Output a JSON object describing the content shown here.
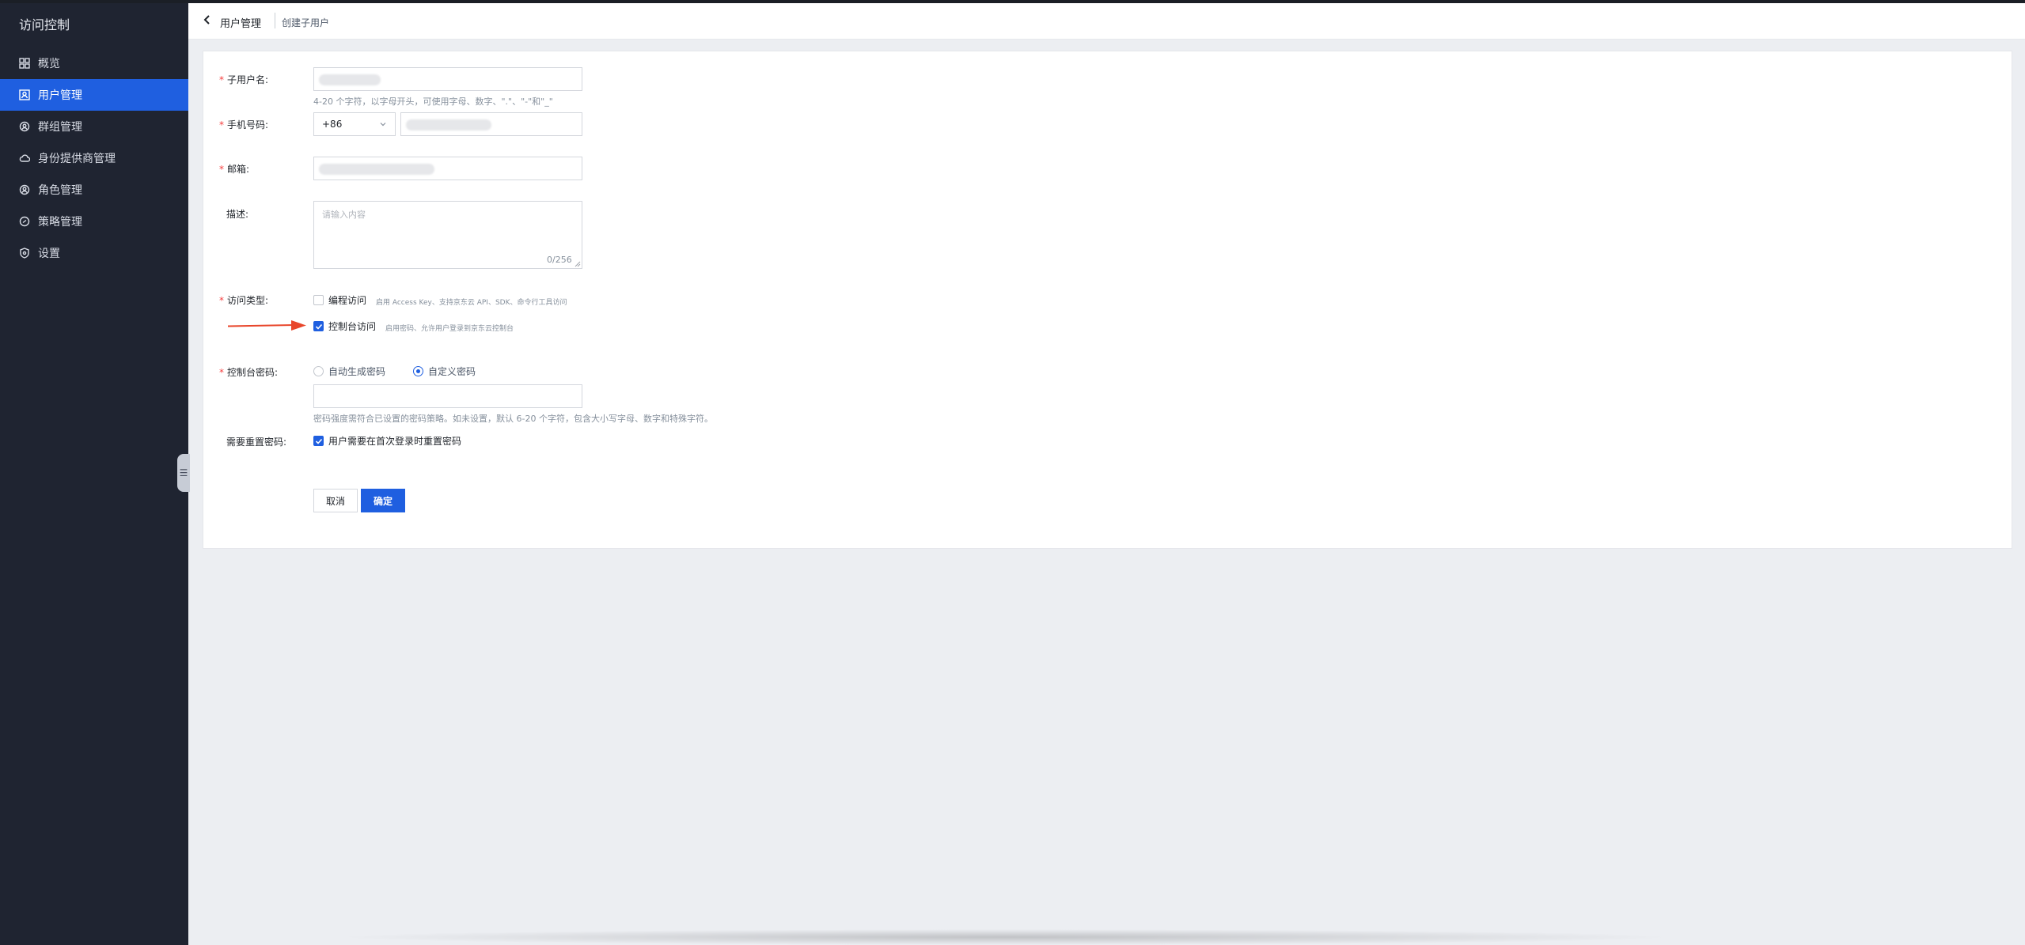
{
  "sidebar": {
    "title": "访问控制",
    "items": [
      {
        "label": "概览",
        "icon": "overview-icon"
      },
      {
        "label": "用户管理",
        "icon": "user-icon",
        "active": true
      },
      {
        "label": "群组管理",
        "icon": "group-icon"
      },
      {
        "label": "身份提供商管理",
        "icon": "cloud-icon"
      },
      {
        "label": "角色管理",
        "icon": "role-icon"
      },
      {
        "label": "策略管理",
        "icon": "policy-icon"
      },
      {
        "label": "设置",
        "icon": "settings-icon"
      }
    ]
  },
  "header": {
    "breadcrumb_main": "用户管理",
    "breadcrumb_sub": "创建子用户"
  },
  "form": {
    "username": {
      "label": "子用户名:",
      "hint": "4-20 个字符，以字母开头，可使用字母、数字、\".\"、\"-\"和\"_\""
    },
    "phone": {
      "label": "手机号码:",
      "country_code": "+86"
    },
    "email": {
      "label": "邮箱:"
    },
    "description": {
      "label": "描述:",
      "placeholder": "请输入内容",
      "counter": "0/256"
    },
    "access_type": {
      "label": "访问类型:",
      "programmatic": {
        "label": "编程访问",
        "hint": "启用 Access Key、支持京东云 API、SDK、命令行工具访问",
        "checked": false
      },
      "console": {
        "label": "控制台访问",
        "hint": "启用密码、允许用户登录到京东云控制台",
        "checked": true
      }
    },
    "console_password": {
      "label": "控制台密码:",
      "auto_label": "自动生成密码",
      "custom_label": "自定义密码",
      "selected": "custom",
      "hint": "密码强度需符合已设置的密码策略。如未设置，默认 6-20 个字符，包含大小写字母、数字和特殊字符。"
    },
    "reset_password": {
      "label": "需要重置密码:",
      "option_label": "用户需要在首次登录时重置密码",
      "checked": true
    },
    "buttons": {
      "cancel": "取消",
      "confirm": "确定"
    }
  },
  "colors": {
    "accent": "#1f5fe0",
    "sidebar_bg": "#1f2431",
    "required": "#f53f3f",
    "arrow": "#e8462b"
  }
}
